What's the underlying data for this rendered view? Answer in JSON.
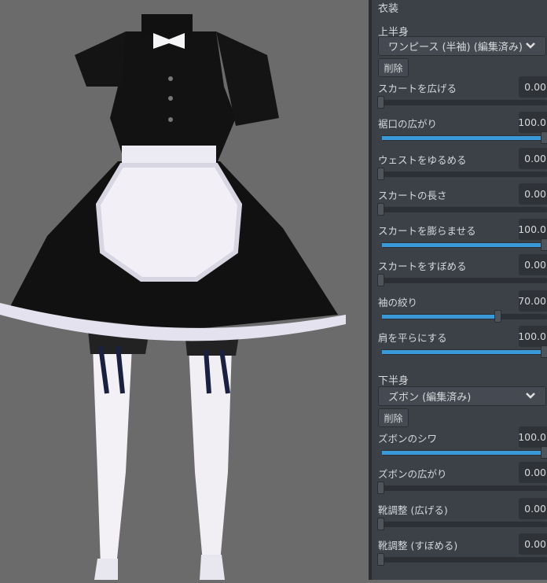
{
  "panel": {
    "title": "衣装",
    "upper": {
      "heading": "上半身",
      "selected": "ワンピース (半袖) (編集済み)",
      "delete_label": "削除",
      "sliders": [
        {
          "label": "スカートを広げる",
          "value": "0.00",
          "percent": 0
        },
        {
          "label": "裾口の広がり",
          "value": "100.0",
          "percent": 100
        },
        {
          "label": "ウェストをゆるめる",
          "value": "0.00",
          "percent": 0
        },
        {
          "label": "スカートの長さ",
          "value": "0.00",
          "percent": 0
        },
        {
          "label": "スカートを膨らませる",
          "value": "100.0",
          "percent": 100
        },
        {
          "label": "スカートをすぼめる",
          "value": "0.00",
          "percent": 0
        },
        {
          "label": "袖の絞り",
          "value": "70.00",
          "percent": 70
        },
        {
          "label": "肩を平らにする",
          "value": "100.0",
          "percent": 100
        }
      ]
    },
    "lower": {
      "heading": "下半身",
      "selected": "ズボン (編集済み)",
      "delete_label": "削除",
      "sliders": [
        {
          "label": "ズボンのシワ",
          "value": "100.0",
          "percent": 100
        },
        {
          "label": "ズボンの広がり",
          "value": "0.00",
          "percent": 0
        },
        {
          "label": "靴調整 (広げる)",
          "value": "0.00",
          "percent": 0
        },
        {
          "label": "靴調整 (すぼめる)",
          "value": "0.00",
          "percent": 0
        }
      ]
    }
  },
  "colors": {
    "accent": "#3a9ad9",
    "panel": "#3c4148",
    "viewport": "#6b6b6b"
  }
}
